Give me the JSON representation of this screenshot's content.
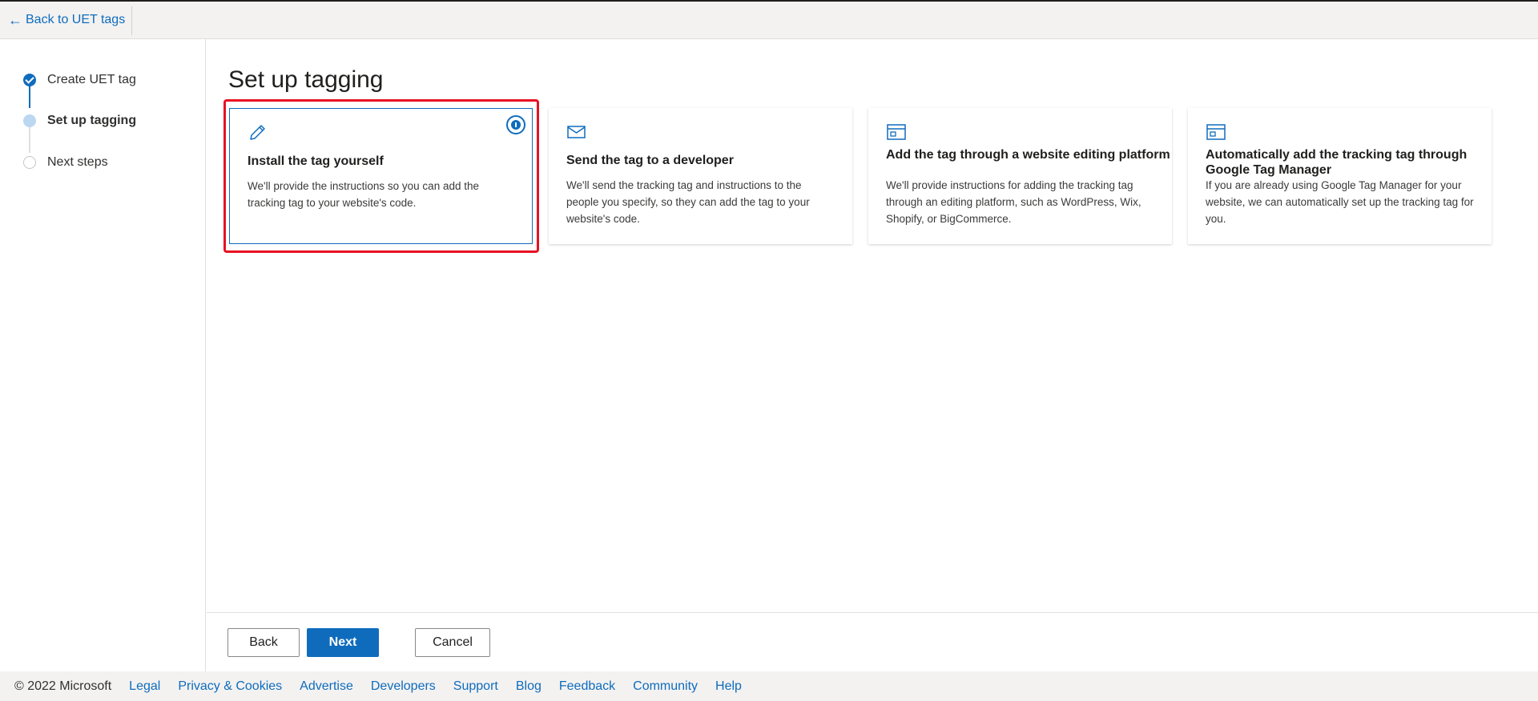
{
  "topbar": {
    "back_label": "Back to UET tags"
  },
  "steps": [
    {
      "label": "Create UET tag",
      "state": "done"
    },
    {
      "label": "Set up tagging",
      "state": "current"
    },
    {
      "label": "Next steps",
      "state": "todo"
    }
  ],
  "page": {
    "title": "Set up tagging"
  },
  "options": [
    {
      "title": "Install the tag yourself",
      "desc": "We'll provide the instructions so you can add the tracking tag to your website's code.",
      "icon": "pencil-icon",
      "selected": true
    },
    {
      "title": "Send the tag to a developer",
      "desc": "We'll send the tracking tag and instructions to the people you specify, so they can add the tag to your website's code.",
      "icon": "mail-icon",
      "selected": false
    },
    {
      "title": "Add the tag through a website editing platform",
      "desc": "We'll provide instructions for adding the tracking tag through an editing platform, such as WordPress, Wix, Shopify, or BigCommerce.",
      "icon": "browser-window-icon",
      "selected": false
    },
    {
      "title": "Automatically add the tracking tag through Google Tag Manager",
      "desc": "If you are already using Google Tag Manager for your website, we can automatically set up the tracking tag for you.",
      "icon": "browser-window-icon",
      "selected": false
    }
  ],
  "actions": {
    "back": "Back",
    "next": "Next",
    "cancel": "Cancel"
  },
  "footer": {
    "copyright": "© 2022 Microsoft",
    "links": [
      "Legal",
      "Privacy & Cookies",
      "Advertise",
      "Developers",
      "Support",
      "Blog",
      "Feedback",
      "Community",
      "Help"
    ]
  },
  "colors": {
    "accent": "#0f6cbd",
    "highlight": "#e81123"
  }
}
